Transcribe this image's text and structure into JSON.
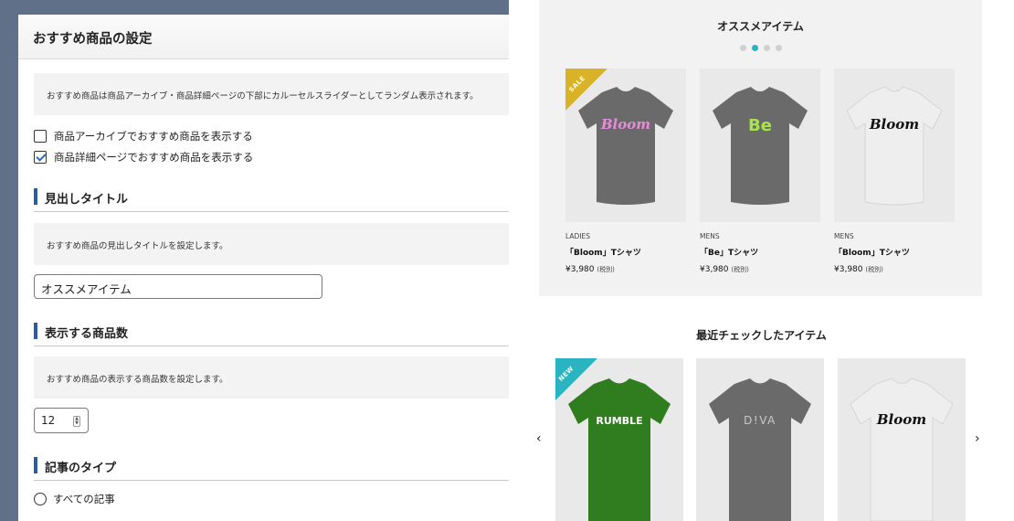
{
  "settings": {
    "title": "おすすめ商品の設定",
    "description": "おすすめ商品は商品アーカイブ・商品詳細ページの下部にカルーセルスライダーとしてランダム表示されます。",
    "checkboxes": [
      {
        "label": "商品アーカイブでおすすめ商品を表示する",
        "checked": false
      },
      {
        "label": "商品詳細ページでおすすめ商品を表示する",
        "checked": true
      }
    ],
    "heading_section": {
      "title": "見出しタイトル",
      "description": "おすすめ商品の見出しタイトルを設定します。",
      "value": "オススメアイテム"
    },
    "count_section": {
      "title": "表示する商品数",
      "description": "おすすめ商品の表示する商品数を設定します。",
      "value": "12"
    },
    "type_section": {
      "title": "記事のタイプ",
      "radio_label": "すべての記事"
    }
  },
  "preview": {
    "recommended_title": "オススメアイテム",
    "carousel_dots": 4,
    "carousel_active_dot": 1,
    "products": [
      {
        "category": "LADIES",
        "name": "「Bloom」Tシャツ",
        "price": "¥3,980",
        "tax": "(税別)",
        "badge": "SALE",
        "badge_color": "#d9b228",
        "shirt_color": "#6a6a6a",
        "print": "Bloom",
        "print_color": "#e58cd9"
      },
      {
        "category": "MENS",
        "name": "「Be」Tシャツ",
        "price": "¥3,980",
        "tax": "(税別)",
        "badge": "",
        "shirt_color": "#6a6a6a",
        "print": "Be",
        "print_color": "#a9e34b"
      },
      {
        "category": "MENS",
        "name": "「Bloom」Tシャツ",
        "price": "¥3,980",
        "tax": "(税別)",
        "badge": "",
        "shirt_color": "#eeeeee",
        "print": "Bloom",
        "print_color": "#111111"
      }
    ],
    "recent_title": "最近チェックしたアイテム",
    "recent_items": [
      {
        "badge": "NEW",
        "badge_color": "#2ab3c1",
        "shirt_color": "#2f7d1e",
        "print": "RUMBLE",
        "print_color": "#ffffff"
      },
      {
        "badge": "",
        "shirt_color": "#6a6a6a",
        "print": "D!VA",
        "print_color": "#c9c9c9"
      },
      {
        "badge": "",
        "shirt_color": "#eeeeee",
        "print": "Bloom",
        "print_color": "#111111"
      }
    ],
    "prev_arrow": "‹",
    "next_arrow": "›"
  }
}
